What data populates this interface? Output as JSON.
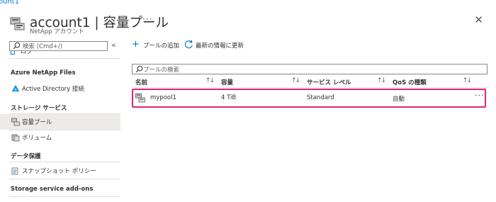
{
  "top_link": "ount1",
  "header": {
    "title": "account1 | 容量プール",
    "subtitle": "NetApp アカウント",
    "more": "···",
    "close": "✕"
  },
  "sidebar": {
    "search_placeholder": "検索 (Cmd+/)",
    "collapse": "«",
    "partial_item": "ログ",
    "sections": {
      "azure_netapp_files": "Azure NetApp Files",
      "storage_service": "ストレージ サービス",
      "data_protection": "データ保護",
      "addons": "Storage service add-ons"
    },
    "items": {
      "active_directory": "Active Directory 接続",
      "capacity_pools": "容量プール",
      "volumes": "ボリューム",
      "snapshot_policies": "スナップショット ポリシー"
    }
  },
  "toolbar": {
    "add_pool": "プールの追加",
    "refresh": "最新の情報に更新"
  },
  "filter": {
    "placeholder": "プールの検索"
  },
  "table": {
    "columns": [
      "名前",
      "容量",
      "サービス レベル",
      "QoS の種類"
    ],
    "rows": [
      {
        "name": "mypool1",
        "capacity": "4 TiB",
        "service_level": "Standard",
        "qos": "自動"
      }
    ]
  },
  "colors": {
    "accent": "#0078d4",
    "highlight": "#e0257a",
    "selected_bg": "#edebe9"
  }
}
